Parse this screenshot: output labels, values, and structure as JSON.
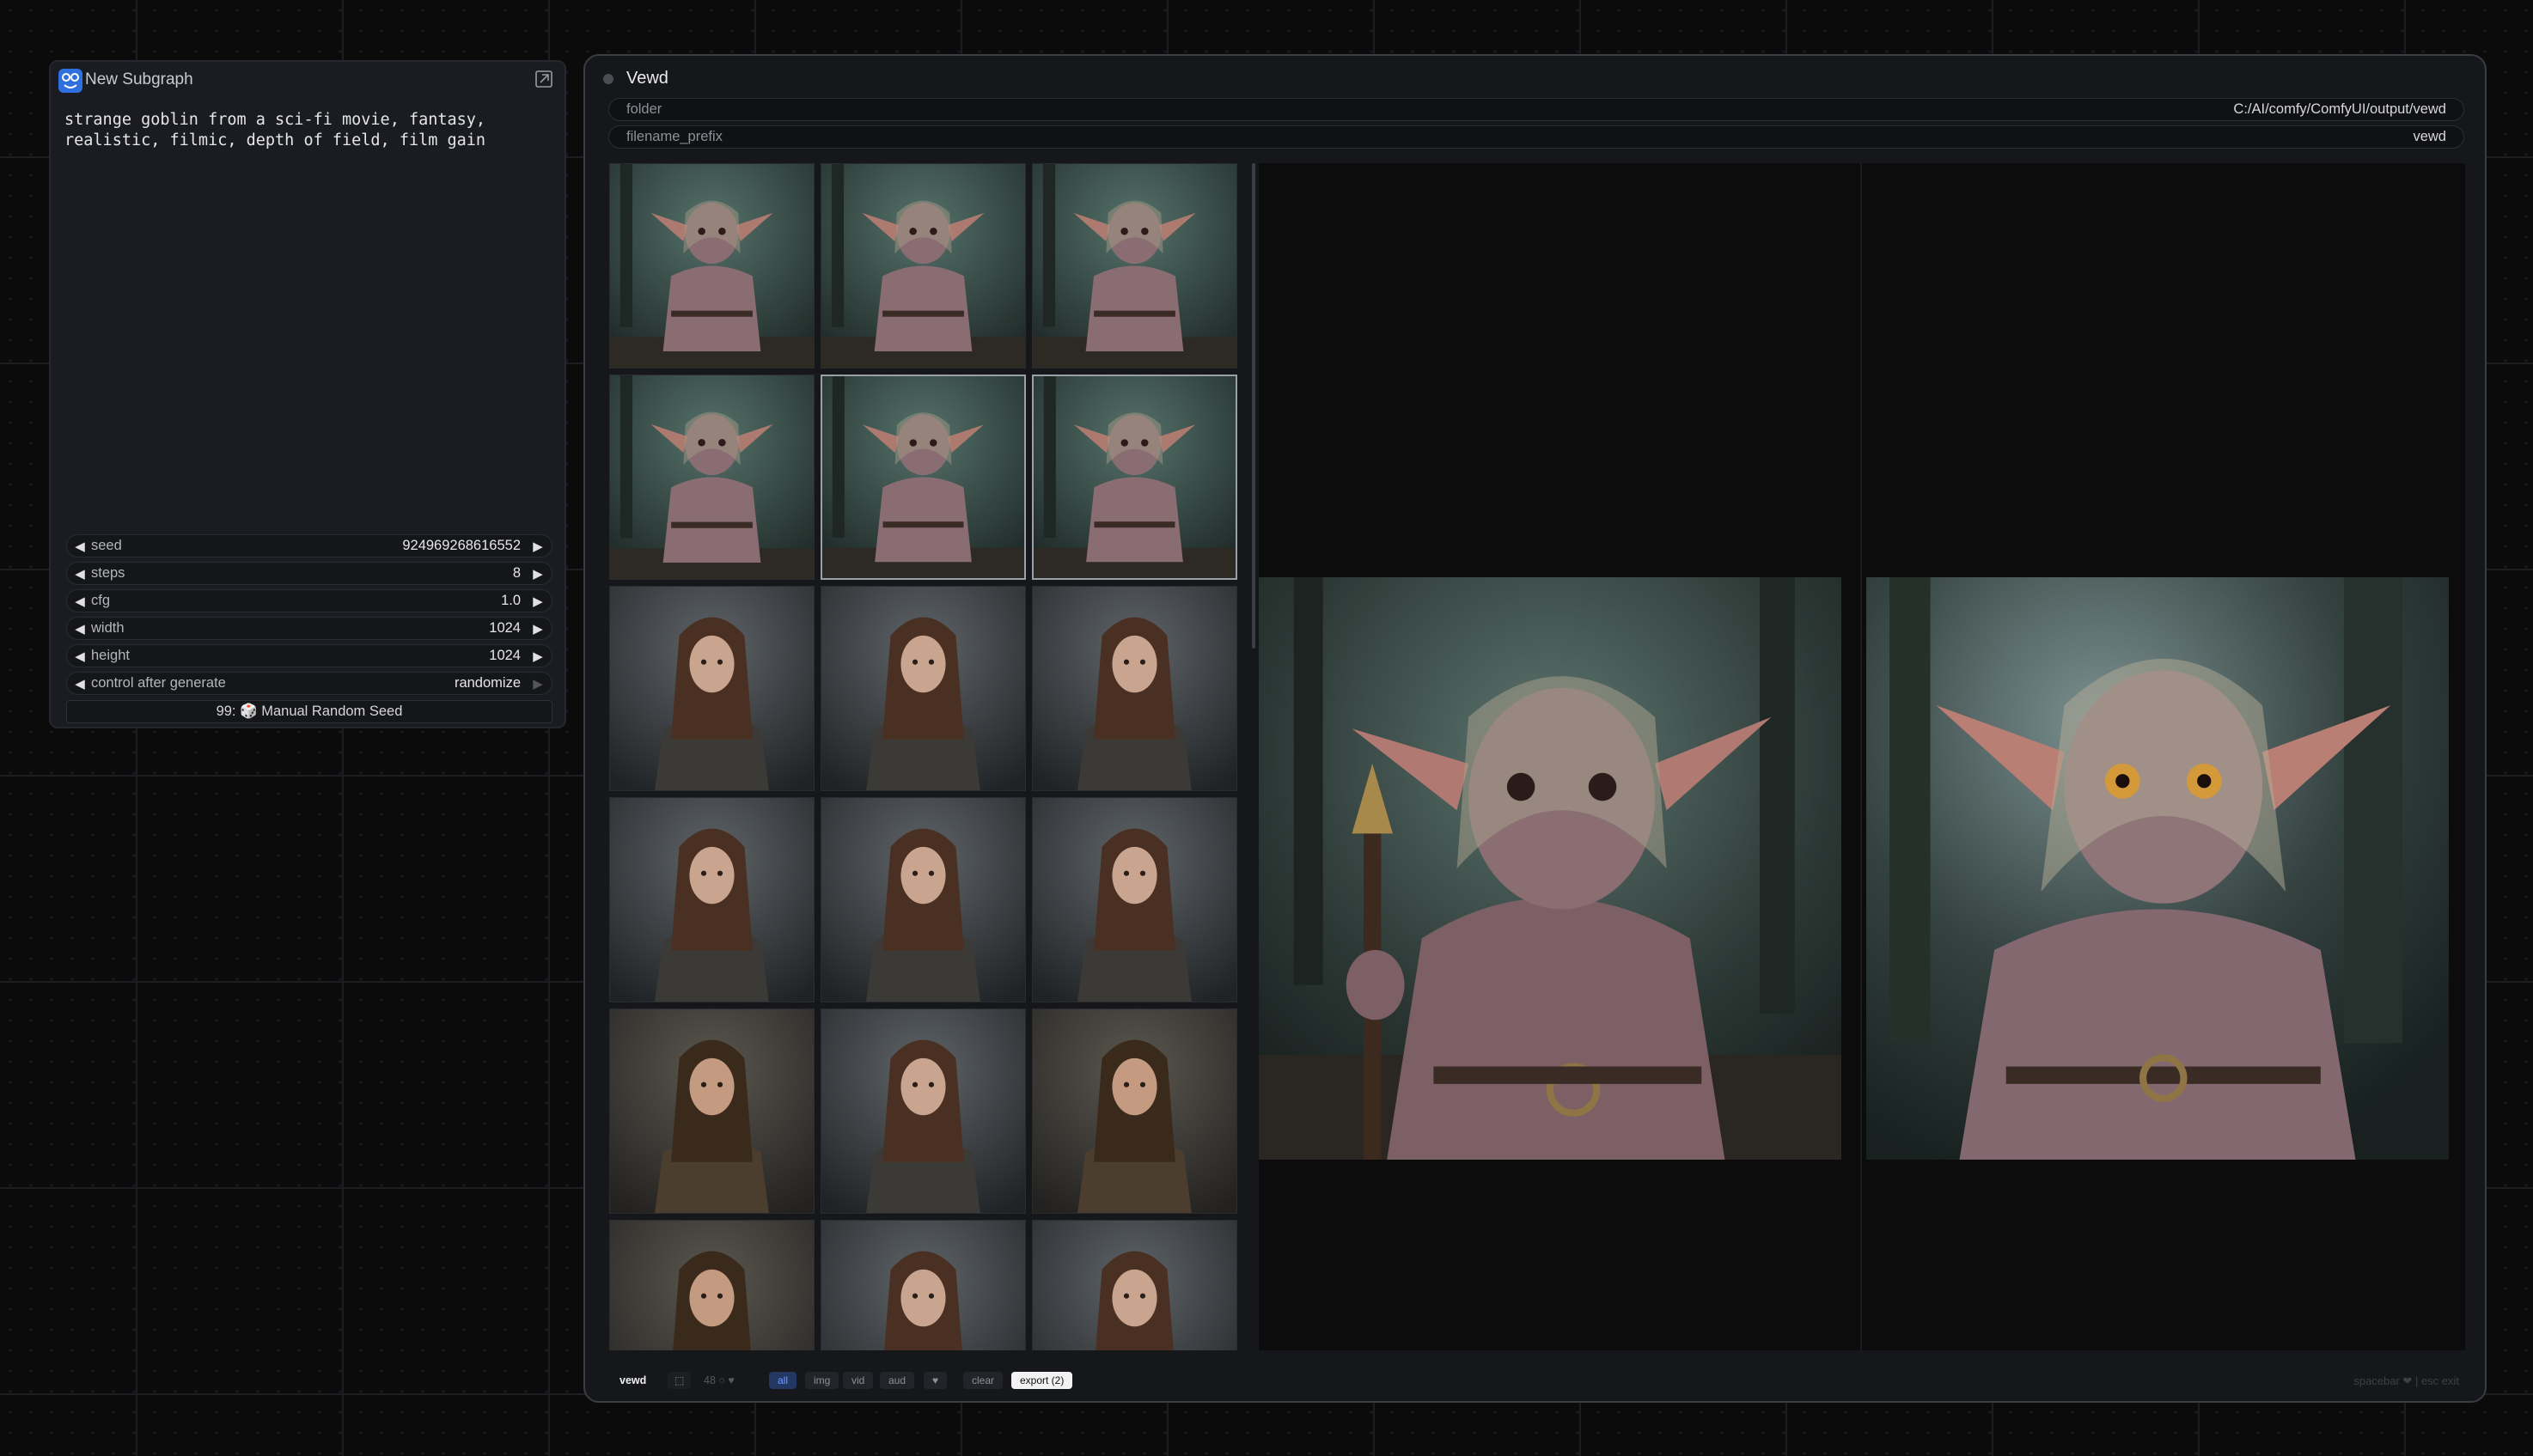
{
  "subgraph": {
    "title": "New Subgraph",
    "icon": "subgraph-logo-icon",
    "prompt": "strange goblin from a sci-fi movie, fantasy,\nrealistic, filmic, depth of field, film gain",
    "widgets": [
      {
        "label": "seed",
        "value": "924969268616552"
      },
      {
        "label": "steps",
        "value": "8"
      },
      {
        "label": "cfg",
        "value": "1.0"
      },
      {
        "label": "width",
        "value": "1024"
      },
      {
        "label": "height",
        "value": "1024"
      },
      {
        "label": "control after generate",
        "value": "randomize"
      }
    ],
    "manual_seed_label": "99: 🎲 Manual Random Seed"
  },
  "vewd": {
    "title": "Vewd",
    "folder_label": "folder",
    "folder_value": "C:/AI/comfy/ComfyUI/output/vewd",
    "prefix_label": "filename_prefix",
    "prefix_value": "vewd",
    "gallery": [
      {
        "subject": "goblin"
      },
      {
        "subject": "goblin"
      },
      {
        "subject": "goblin"
      },
      {
        "subject": "goblin"
      },
      {
        "subject": "goblin",
        "selected": true
      },
      {
        "subject": "goblin",
        "selected": true
      },
      {
        "subject": "woman"
      },
      {
        "subject": "woman"
      },
      {
        "subject": "woman"
      },
      {
        "subject": "woman"
      },
      {
        "subject": "woman"
      },
      {
        "subject": "woman"
      },
      {
        "subject": "man"
      },
      {
        "subject": "woman"
      },
      {
        "subject": "man"
      },
      {
        "subject": "man"
      },
      {
        "subject": "woman"
      },
      {
        "subject": "woman"
      }
    ],
    "bottom_bar": {
      "name": "vewd",
      "grid_icon": "grid-icon",
      "count": "48",
      "filter_all": "all",
      "filter_img": "img",
      "filter_vid": "vid",
      "filter_aud": "aud",
      "fav_icon": "heart-icon",
      "clear": "clear",
      "export": "export (2)",
      "hint": "spacebar ❤ | esc exit"
    }
  },
  "colors": {
    "accent_blue": "#2f6fe0",
    "active_filter": "#6f9cff",
    "canvas_bg": "#0b0b0c"
  }
}
